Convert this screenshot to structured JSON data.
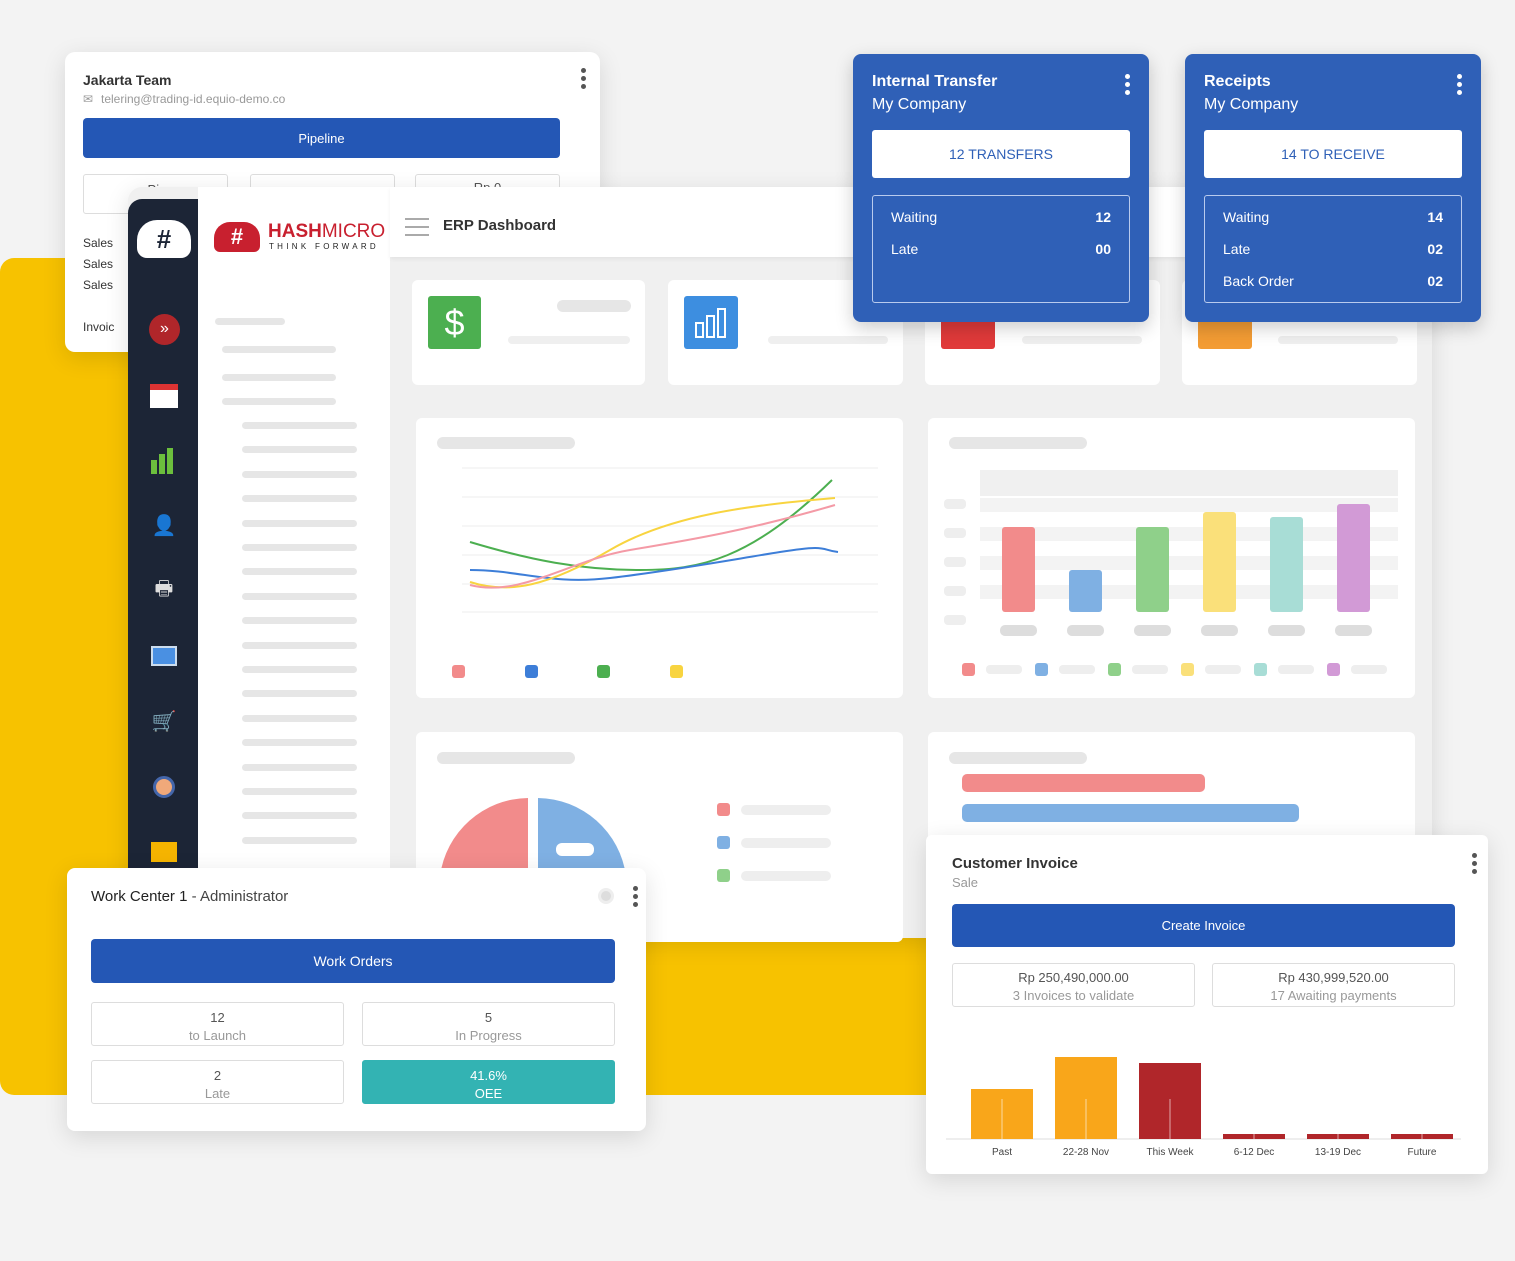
{
  "jakarta_card": {
    "title": "Jakarta Team",
    "email": "telering@trading-id.equio-demo.co",
    "pipeline_button": "Pipeline",
    "stat_partial_1": "Pir",
    "stat_partial_3": "Rp 0",
    "list_items": [
      "Sales",
      "Sales",
      "Sales"
    ],
    "invoice_partial": "Invoic"
  },
  "dashboard": {
    "logo_brand_a": "HASH",
    "logo_brand_b": "MICRO",
    "logo_tagline": "THINK FORWARD",
    "title": "ERP Dashboard",
    "icons": [
      "dollar-icon",
      "bar-chart-icon",
      "invoice-icon",
      "clock-icon"
    ]
  },
  "sidebar": {
    "icons": [
      "expand-icon",
      "calendar-icon",
      "chart-icon",
      "employee-icon",
      "printer-icon",
      "computer-icon",
      "cart-icon",
      "support-icon",
      "inventory-icon"
    ]
  },
  "internal_transfer": {
    "title": "Internal Transfer",
    "company": "My Company",
    "button": "12 TRANSFERS",
    "rows": [
      {
        "label": "Waiting",
        "value": "12"
      },
      {
        "label": "Late",
        "value": "00"
      }
    ]
  },
  "receipts": {
    "title": "Receipts",
    "company": "My Company",
    "button": "14 TO RECEIVE",
    "rows": [
      {
        "label": "Waiting",
        "value": "14"
      },
      {
        "label": "Late",
        "value": "02"
      },
      {
        "label": "Back Order",
        "value": "02"
      }
    ]
  },
  "work_center": {
    "title": "Work Center 1",
    "subtitle": "- Administrator",
    "button": "Work Orders",
    "stats": [
      {
        "value": "12",
        "label": "to Launch"
      },
      {
        "value": "5",
        "label": "In Progress"
      },
      {
        "value": "2",
        "label": "Late"
      },
      {
        "value": "41.6%",
        "label": "OEE"
      }
    ]
  },
  "customer_invoice": {
    "title": "Customer Invoice",
    "subtitle": "Sale",
    "button": "Create Invoice",
    "stats": [
      {
        "value": "Rp 250,490,000.00",
        "label": "3 Invoices to validate"
      },
      {
        "value": "Rp 430,999,520.00",
        "label": "17 Awaiting payments"
      }
    ]
  },
  "colors": {
    "accent_blue": "#2457b5",
    "yellow": "#f7c200",
    "teal": "#33b3b3",
    "orange": "#f9a61a",
    "dark_red": "#b0262a",
    "sidebar": "#1c2536"
  },
  "chart_data": [
    {
      "type": "bar",
      "categories": [
        "Past",
        "22-28 Nov",
        "This Week",
        "6-12 Dec",
        "13-19 Dec",
        "Future"
      ],
      "values": [
        50,
        82,
        76,
        5,
        5,
        5
      ],
      "colors": [
        "#f9a61a",
        "#f9a61a",
        "#b0262a",
        "#b0262a",
        "#b0262a",
        "#b0262a"
      ]
    },
    {
      "type": "bar",
      "values": [
        85,
        42,
        85,
        100,
        95,
        108
      ],
      "colors": [
        "#f28b8b",
        "#7fb0e3",
        "#8fd08a",
        "#fae07a",
        "#a8ddd6",
        "#d29ad6"
      ]
    }
  ]
}
